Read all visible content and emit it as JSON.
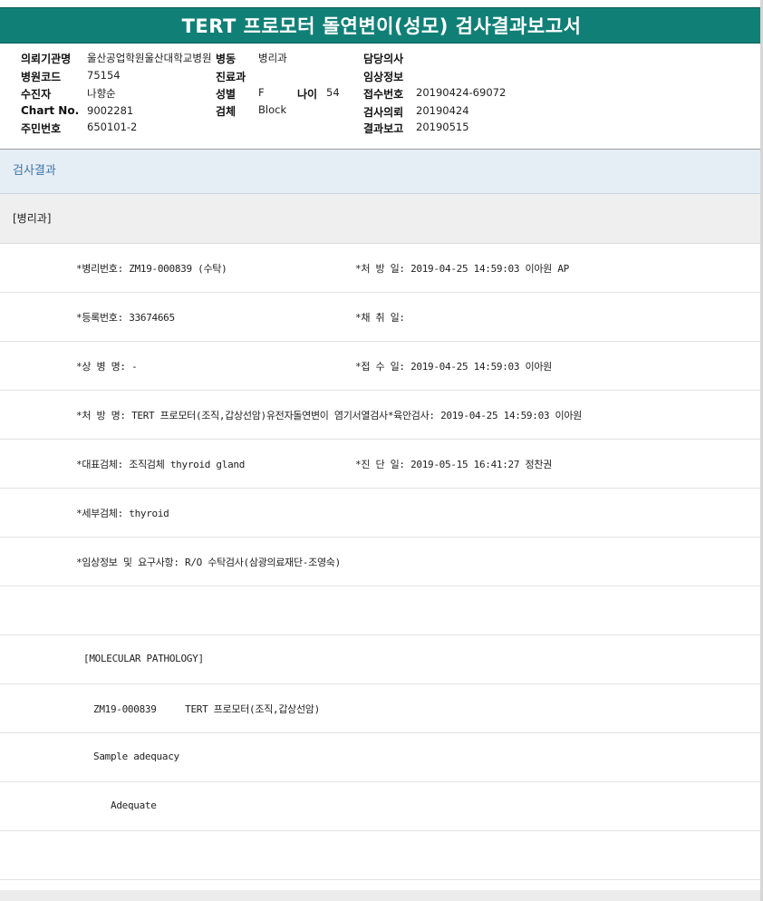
{
  "title": "TERT 프로모터 돌연변이(성모) 검사결과보고서",
  "info": {
    "col1": [
      {
        "label": "의뢰기관명",
        "value": "울산공업학원울산대학교병원"
      },
      {
        "label": "병원코드",
        "value": "75154"
      },
      {
        "label": "수진자",
        "value": "나향순"
      },
      {
        "label": "Chart No.",
        "value": "9002281"
      },
      {
        "label": "주민번호",
        "value": "650101-2"
      }
    ],
    "col2": [
      {
        "label": "병동",
        "value": "병리과"
      },
      {
        "label": "진료과",
        "value": ""
      },
      {
        "label": "성별",
        "value": "F"
      },
      {
        "label": "검체",
        "value": "Block"
      }
    ],
    "age": {
      "label": "나이",
      "value": "54"
    },
    "col3": [
      {
        "label": "담당의사",
        "value": ""
      },
      {
        "label": "임상정보",
        "value": ""
      },
      {
        "label": "접수번호",
        "value": "20190424-69072"
      },
      {
        "label": "검사의뢰",
        "value": "20190424"
      },
      {
        "label": "결과보고",
        "value": "20190515"
      }
    ]
  },
  "section_header": "검사결과",
  "department": "[병리과]",
  "rows": {
    "r1_left": "*병리번호: ZM19-000839 (수탁)",
    "r1_right": "*처 방 일: 2019-04-25 14:59:03  이아원 AP",
    "r2_left": "*등록번호: 33674665",
    "r2_right": "*채 취 일:",
    "r3_left": "*상 병 명: -",
    "r3_right": "*접 수 일: 2019-04-25 14:59:03  이아원",
    "r4_left": "*처 방 명: TERT 프로모터(조직,갑상선암)유전자돌연변이 염기서열검사*육안검사: 2019-04-25 14:59:03  이아원",
    "r5_left": "*대표검체: 조직검체 thyroid gland",
    "r5_right": "*진 단 일: 2019-05-15 16:41:27  정찬권",
    "r6_left": "*세부검체: thyroid",
    "r7_left": "*임상정보 및 요구사항: R/O 수탁검사(삼광의료재단-조영숙)",
    "r9": "[MOLECULAR PATHOLOGY]",
    "r10": "ZM19-000839     TERT 프로모터(조직,갑상선암)",
    "r11": "Sample adequacy",
    "r12": "Adequate"
  }
}
